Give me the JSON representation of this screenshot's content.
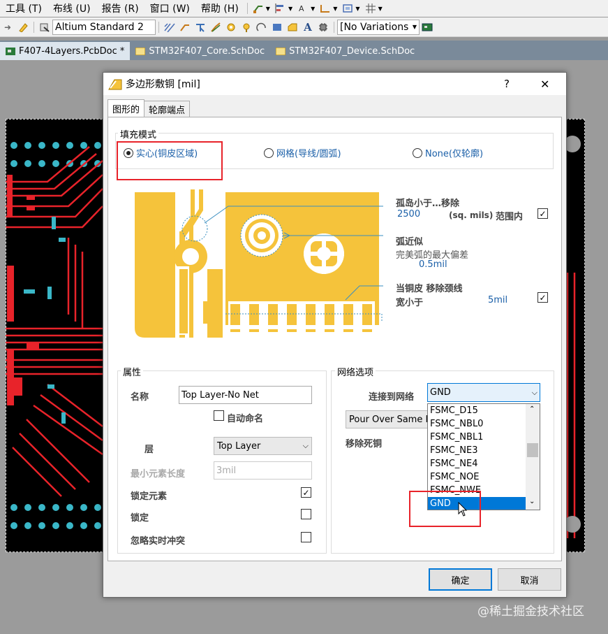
{
  "menu": {
    "items": [
      "工具 (T)",
      "布线 (U)",
      "报告 (R)",
      "窗口 (W)",
      "帮助 (H)"
    ]
  },
  "toolbar": {
    "standard_combo": "Altium Standard 2",
    "variations_combo": "[No Variations"
  },
  "doc_tabs": [
    {
      "label": "F407-4Layers.PcbDoc *",
      "active": true
    },
    {
      "label": "STM32F407_Core.SchDoc",
      "active": false
    },
    {
      "label": "STM32F407_Device.SchDoc",
      "active": false
    }
  ],
  "dialog": {
    "title": "多边形敷铜 [mil]",
    "help": "?",
    "close": "✕",
    "tabs": [
      "图形的",
      "轮廓端点"
    ],
    "fill_mode": {
      "label": "填充模式",
      "options": [
        "实心(铜皮区域)",
        "网格(导线/圆弧)",
        "None(仅轮廓)"
      ],
      "selected": 0
    },
    "island": {
      "label": "孤岛小于…移除",
      "value": "2500",
      "unit": "(sq. mils)",
      "scope": "范围内",
      "checked": true
    },
    "arc": {
      "label": "弧近似",
      "sublabel": "完美弧的最大偏差",
      "value": "0.5mil"
    },
    "neck": {
      "label": "当铜皮 移除颈线",
      "sublabel": "宽小于",
      "value": "5mil",
      "checked": true
    },
    "properties": {
      "label": "属性",
      "name_label": "名称",
      "name_value": "Top Layer-No Net",
      "auto_name_label": "自动命名",
      "auto_name_checked": false,
      "layer_label": "层",
      "layer_value": "Top Layer",
      "min_length_label": "最小元素长度",
      "min_length_value": "3mil",
      "lock_primitives_label": "锁定元素",
      "lock_primitives_checked": true,
      "locked_label": "锁定",
      "locked_checked": false,
      "ignore_drc_label": "忽略实时冲突",
      "ignore_drc_checked": false
    },
    "net_options": {
      "label": "网络选项",
      "connect_label": "连接到网络",
      "connect_value": "GND",
      "pour_value": "Pour Over Same N",
      "remove_dead_label": "移除死铜",
      "dropdown_items": [
        "FSMC_D15",
        "FSMC_NBL0",
        "FSMC_NBL1",
        "FSMC_NE3",
        "FSMC_NE4",
        "FSMC_NOE",
        "FSMC_NWE",
        "GND"
      ],
      "dropdown_selected": "GND"
    },
    "ok_label": "确定",
    "cancel_label": "取消"
  },
  "watermark": "@稀土掘金技术社区",
  "colors": {
    "copper": "#f5c33b",
    "accent": "#0078d7",
    "annotation": "#e8232a",
    "pcb_trace": "#e8232a",
    "pcb_pad": "#3ab7c8"
  }
}
